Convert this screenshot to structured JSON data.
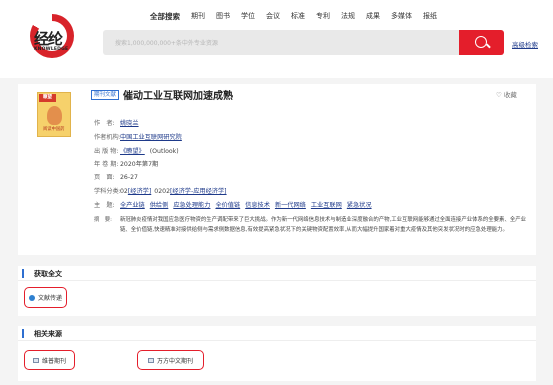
{
  "header": {
    "logo_text": "经纶",
    "logo_sub": "KNOWLEDGE",
    "nav": [
      "全部搜索",
      "期刊",
      "图书",
      "学位",
      "会议",
      "标准",
      "专利",
      "法规",
      "成果",
      "多媒体",
      "报纸"
    ],
    "search_placeholder": "搜索1,000,000,000+条中外专业资源",
    "advanced_search": "高级检索"
  },
  "article": {
    "badge": "期刊文献",
    "title": "催动工业互联网加速成熟",
    "favorite": "收藏",
    "cover": {
      "masthead": "瞭望",
      "caption": "阅读中国药"
    },
    "fields": {
      "author": {
        "label": "作　者:",
        "value": "姚晓兰"
      },
      "institution": {
        "label": "作者机构:",
        "value": "中国工业互联网研究院"
      },
      "source": {
        "label": "出 版 物:",
        "value": "《瞭望》",
        "extra": "(Outlook)"
      },
      "year": {
        "label": "年 卷 期:",
        "value": "2020年第7期"
      },
      "pages": {
        "label": "页　面:",
        "value": "26-27"
      },
      "subject": {
        "label": "学科分类:",
        "code1": "02",
        "link1": "[经济学]",
        "code2": "0202",
        "link2": "[经济学-应用经济学]"
      },
      "keywords": {
        "label": "主　题:",
        "items": [
          "全产业链",
          "供给侧",
          "应急处理能力",
          "全价值链",
          "信息技术",
          "新一代网络",
          "工业互联网",
          "紧急状况"
        ]
      },
      "abstract": {
        "label": "摘　要:",
        "value": "新冠肺炎疫情对我国应急医疗物资的生产调配带来了巨大挑战。作为新一代网络信息技术与制造业深度融合的产物,工业互联网能够通过全面连接产业体系的全要素、全产业链、全价值链,快速精准对接供给侧与需求侧数据信息,有效提高紧急状况下的关键物资配置效率,从而大幅提升国家着对重大疫情及其他突发状况时的应急处理能力。"
      }
    }
  },
  "fulltext": {
    "title": "获取全文",
    "button": "文献传递"
  },
  "sources": {
    "title": "相关来源",
    "items": [
      "维普期刊",
      "万方中文期刊"
    ]
  },
  "colors": {
    "accent": "#e41e2b",
    "link": "#1e3a8a",
    "blue": "#2f6fd0"
  }
}
